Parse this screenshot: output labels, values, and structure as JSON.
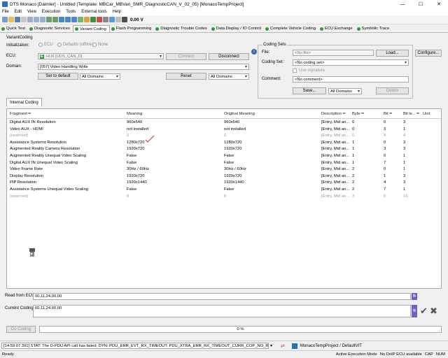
{
  "window": {
    "title": "DTS Monaco [Daimler] - Untitled (Template: MBCar_MBVan_SMR_DiagnosticCAN_V_02_05) [MonacoTempProject]",
    "min": "—",
    "max": "☐",
    "close": "✕"
  },
  "menu": [
    "File",
    "Edit",
    "View",
    "Execution",
    "Tools",
    "External tools",
    "Help"
  ],
  "toolbar": {
    "voltage": "0.00 V"
  },
  "tabs": [
    {
      "label": "Quick Test"
    },
    {
      "label": "Diagnostic Services"
    },
    {
      "label": "Variant Coding"
    },
    {
      "label": "Flash Programming"
    },
    {
      "label": "Diagnostic Trouble Codes"
    },
    {
      "label": "Data Display / IO Control"
    },
    {
      "label": "Complete Vehicle Coding"
    },
    {
      "label": "ECU Exchange"
    },
    {
      "label": "Symbolic Trace"
    }
  ],
  "variant_coding": {
    "group_title": "VariantCoding",
    "initialization_label": "Initialization:",
    "radio_ecu": "ECU",
    "radio_defaults": "Defaults (offline)",
    "radio_none": "None",
    "ecu_label": "ECU:",
    "ecu_badge": "E",
    "ecu_value": "HU6 [UDS_CAN_D]",
    "connect": "Connect",
    "disconnect": "Disconnect",
    "domain_label": "Domain:",
    "domain_value": "[057] Video Handling Write",
    "set_to_default": "Set to default",
    "all_domains_1": "All Domains",
    "reset": "Reset",
    "all_domains_2": "All Domains"
  },
  "coding_sets": {
    "title": "Coding Sets",
    "file_label": "File:",
    "file_value": "<No file>",
    "load": "Load...",
    "configure": "Configure...",
    "coding_set_label": "Coding Set:",
    "coding_set_value": "<No coding set>",
    "use_signature": "Use signature",
    "comment_label": "Comment:",
    "comment_value": "<No comment>",
    "save": "Save...",
    "all_domains": "All Domains",
    "delete": "Delete"
  },
  "internal_coding_tab": "Internal Coding",
  "table": {
    "headers": [
      "Fragment",
      "Meaning",
      "Original Meaning",
      "Description",
      "Byte",
      "Bit",
      "Bit le...",
      "Unit"
    ],
    "rows": [
      {
        "fragment": "Digital AUX IN Resolution",
        "meaning": "960x540",
        "original": "960x540",
        "desc": "[Entry, Mid an...",
        "byte": "0",
        "bit": "0",
        "bitlen": "3",
        "greyed": false
      },
      {
        "fragment": "Video AUX - HDMI",
        "meaning": "not installed",
        "original": "not installed",
        "desc": "[Entry, Mid an...",
        "byte": "0",
        "bit": "3",
        "bitlen": "1",
        "greyed": false
      },
      {
        "fragment": "(reserved)",
        "meaning": "0",
        "original": "0",
        "desc": "[Entry, Mid an...",
        "byte": "0",
        "bit": "4",
        "bitlen": "4",
        "greyed": true
      },
      {
        "fragment": "Assistance Systems Resolution",
        "meaning": "1280x720",
        "original": "1280x720",
        "desc": "[Entry, Mid an...",
        "byte": "1",
        "bit": "0",
        "bitlen": "3",
        "greyed": false
      },
      {
        "fragment": "Augmented Reality Camera Resolution",
        "meaning": "1920x720",
        "original": "1920x720",
        "desc": "[Entry, Mid an...",
        "byte": "1",
        "bit": "3",
        "bitlen": "3",
        "greyed": false
      },
      {
        "fragment": "Augmented Reality Unequal Video Scaling",
        "meaning": "False",
        "original": "False",
        "desc": "[Entry, Mid an...",
        "byte": "1",
        "bit": "6",
        "bitlen": "1",
        "greyed": false
      },
      {
        "fragment": "Digital AUX IN Unequal Video Scaling",
        "meaning": "False",
        "original": "False",
        "desc": "[Entry, Mid an...",
        "byte": "1",
        "bit": "7",
        "bitlen": "1",
        "greyed": false
      },
      {
        "fragment": "Video Frame Rate",
        "meaning": "30Hz / 60Hz",
        "original": "30Hz / 60Hz",
        "desc": "[Entry, Mid an...",
        "byte": "2",
        "bit": "0",
        "bitlen": "1",
        "greyed": false
      },
      {
        "fragment": "Display Resolution",
        "meaning": "1920x720",
        "original": "1920x720",
        "desc": "[Entry, Mid an...",
        "byte": "2",
        "bit": "1",
        "bitlen": "3",
        "greyed": false
      },
      {
        "fragment": "PIP Resolution",
        "meaning": "1920x1440",
        "original": "1920x1440",
        "desc": "[Entry, Mid an...",
        "byte": "2",
        "bit": "4",
        "bitlen": "3",
        "greyed": false
      },
      {
        "fragment": "Assistance Systems Unequal Video Scaling",
        "meaning": "False",
        "original": "False",
        "desc": "[Entry, Mid an...",
        "byte": "2",
        "bit": "7",
        "bitlen": "1",
        "greyed": false
      },
      {
        "fragment": "(reserved)",
        "meaning": "0",
        "original": "0",
        "desc": "[Entry, Mid an...",
        "byte": "3",
        "bit": "0",
        "bitlen": "16",
        "greyed": true
      }
    ]
  },
  "read_from_ecu": {
    "label": "Read from ECU:",
    "value": "00,11,24,00,00",
    "h": "h"
  },
  "current_coding": {
    "label": "Current Coding:",
    "value": "00,11,24,00,00",
    "h": "h"
  },
  "do_coding": "Do Coding",
  "progress": {
    "text": "0 %",
    "fraction": 0
  },
  "log_message": "[14:59:07.391] STAT: The D-PDU API call has failed; DYN: PDU_ERR_EVT_RX_TIMEOUT: PDU_XTRA_ERR_RX_TIMEOUT_CURR_COP_NO_RSP (24",
  "project_label": "MonacoTempProject / DefaultVIT",
  "status": {
    "ready": "Ready",
    "mode": "Active Execution Mode",
    "doip": "No DoIP ECU available",
    "cap": "CAP",
    "num": "NUM"
  },
  "colors": {
    "accent_blue": "#2a6fb8",
    "green_dot": "#2e9b3a",
    "h_button": "#6b63c9",
    "red_mark": "#c0392b"
  }
}
